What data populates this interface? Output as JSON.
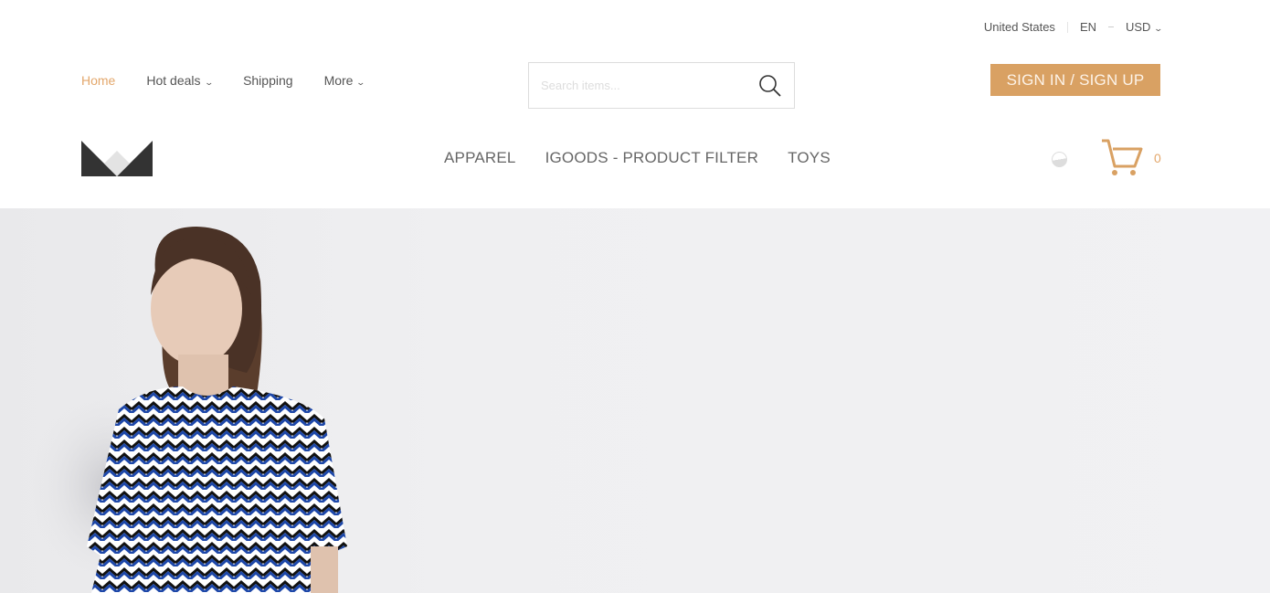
{
  "topbar": {
    "country": "United States",
    "language": "EN",
    "currency": "USD"
  },
  "nav": [
    {
      "label": "Home",
      "active": true
    },
    {
      "label": "Hot deals",
      "dropdown": true
    },
    {
      "label": "Shipping"
    },
    {
      "label": "More",
      "dropdown": true
    }
  ],
  "search": {
    "placeholder": "Search items...",
    "value": "",
    "icon": "search-icon"
  },
  "auth": {
    "label": "SIGN IN / SIGN UP"
  },
  "categories": [
    "APPAREL",
    "IGOODS - PRODUCT FILTER",
    "TOYS"
  ],
  "cart": {
    "count": "0",
    "icon": "cart-icon"
  },
  "colors": {
    "accent": "#d9a163",
    "link_active": "#e3a76b",
    "logo": "#333333"
  }
}
